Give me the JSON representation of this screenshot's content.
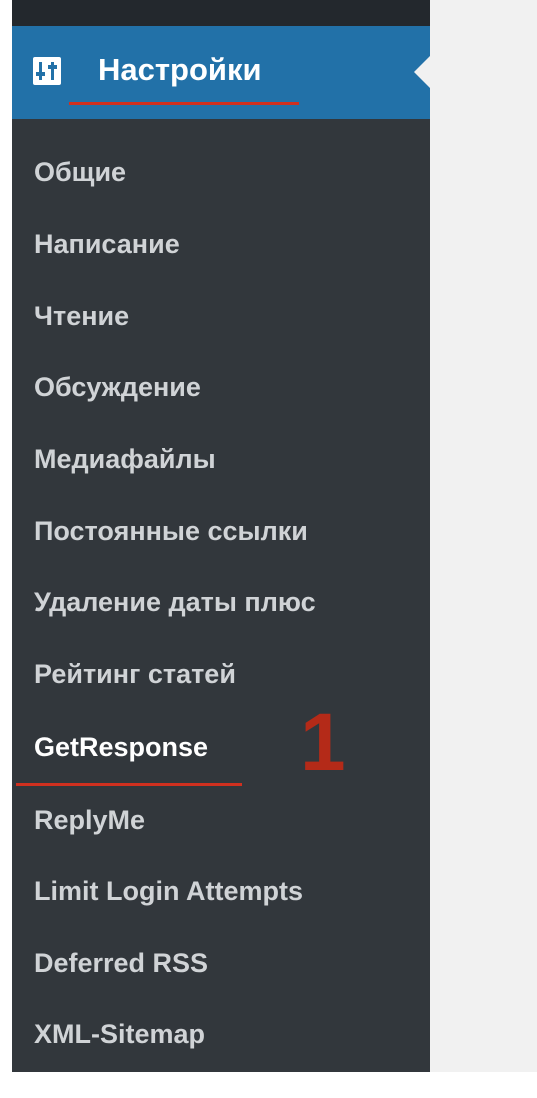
{
  "menu": {
    "section_label": "Настройки",
    "section_icon": "settings-sliders-icon",
    "items": [
      "Общие",
      "Написание",
      "Чтение",
      "Обсуждение",
      "Медиафайлы",
      "Постоянные ссылки",
      "Удаление даты плюс",
      "Рейтинг статей",
      "GetResponse",
      "ReplyMe",
      "Limit Login Attempts",
      "Deferred RSS",
      "XML-Sitemap"
    ],
    "highlighted_item": "GetResponse"
  },
  "annotation": {
    "marker_text": "1"
  },
  "colors": {
    "sidebar_bg": "#32373c",
    "active_bg": "#2271a8",
    "item_text": "#d0d3d6",
    "annotation_red": "#d0301f"
  }
}
